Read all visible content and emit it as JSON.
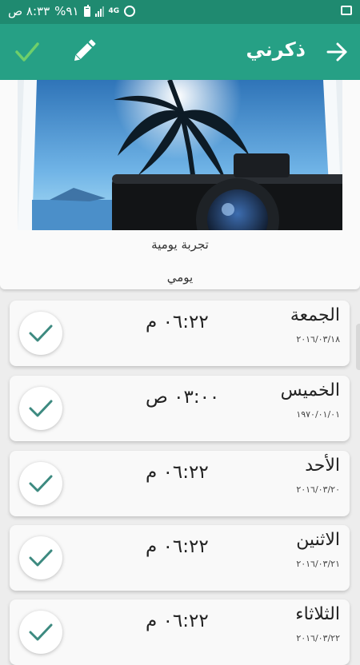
{
  "status_bar": {
    "time": "٨:٣٣ ص",
    "battery": "%٩١",
    "network": "4G"
  },
  "app_bar": {
    "title": "ذكرني"
  },
  "habit": {
    "name": "تجربة يومية",
    "frequency": "يومي"
  },
  "days": [
    {
      "day": "الجمعة",
      "date": "٢٠١٦/٠٣/١٨",
      "time": "٠٦:٢٢ م",
      "checked": true
    },
    {
      "day": "الخميس",
      "date": "١٩٧٠/٠١/٠١",
      "time": "٠٣:٠٠ ص",
      "checked": true
    },
    {
      "day": "الأحد",
      "date": "٢٠١٦/٠٣/٢٠",
      "time": "٠٦:٢٢ م",
      "checked": true
    },
    {
      "day": "الاثنين",
      "date": "٢٠١٦/٠٣/٢١",
      "time": "٠٦:٢٢ م",
      "checked": true
    },
    {
      "day": "الثلاثاء",
      "date": "٢٠١٦/٠٣/٢٢",
      "time": "٠٦:٢٢ م",
      "checked": true
    }
  ],
  "colors": {
    "status_bar": "#1f8a70",
    "app_bar": "#26a085",
    "check_mark": "#3d8a80"
  },
  "icons": [
    "alarm-icon",
    "network-4g-icon",
    "signal-icon",
    "battery-icon",
    "image-icon",
    "back-arrow-icon",
    "pencil-icon",
    "check-icon"
  ]
}
